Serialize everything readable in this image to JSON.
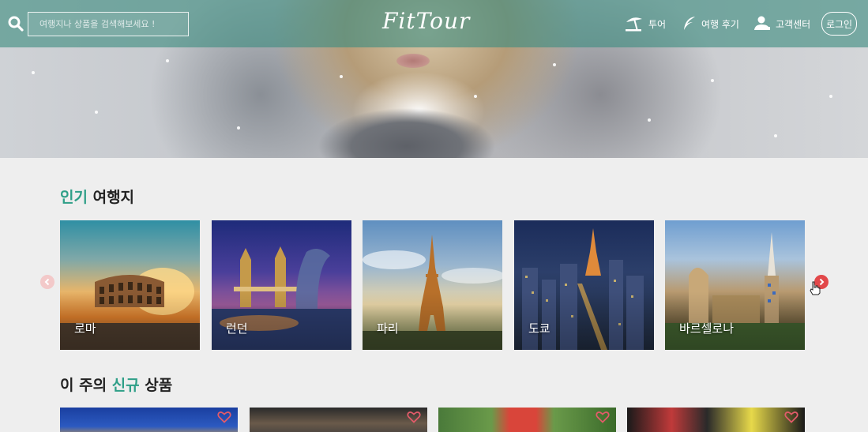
{
  "header": {
    "logo": "FitTour",
    "search": {
      "placeholder": "여행지나 상품을 검색해보세요 !",
      "value": ""
    },
    "nav": [
      {
        "label": "투어",
        "icon": "beach-umbrella-icon"
      },
      {
        "label": "여행 후기",
        "icon": "quill-icon"
      },
      {
        "label": "고객센터",
        "icon": "customer-service-icon"
      }
    ],
    "login_label": "로그인"
  },
  "popular": {
    "title_accent": "인기",
    "title_rest": " 여행지",
    "destinations": [
      {
        "name": "로마"
      },
      {
        "name": "런던"
      },
      {
        "name": "파리"
      },
      {
        "name": "도쿄"
      },
      {
        "name": "바르셀로나"
      }
    ]
  },
  "weekly": {
    "title_pre": "이 주의 ",
    "title_accent": "신규",
    "title_post": " 상품"
  },
  "colors": {
    "accent": "#2f9f88",
    "header_bar": "#3e8c80",
    "arrow_active": "#e2484a",
    "arrow_inactive": "#f3c9c9",
    "heart": "#e25b6a"
  }
}
